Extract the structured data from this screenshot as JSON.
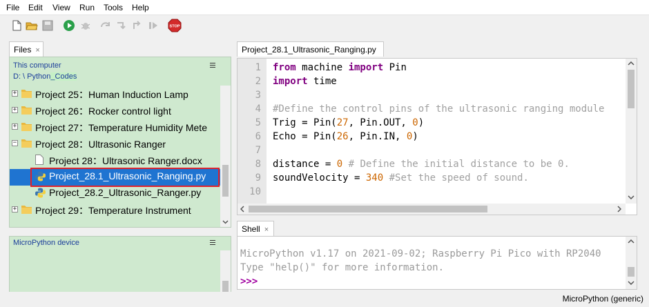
{
  "menu": [
    "File",
    "Edit",
    "View",
    "Run",
    "Tools",
    "Help"
  ],
  "toolbar": [
    "new-file-icon",
    "open-folder-icon",
    "save-icon",
    "run-icon",
    "debug-icon",
    "step-over-icon",
    "step-into-icon",
    "step-out-icon",
    "resume-icon",
    "stop-icon"
  ],
  "stop_label": "STOP",
  "files": {
    "tab_label": "Files",
    "tab_close": "×",
    "location": "This computer",
    "path_prefix": "D: \\ Python",
    "path_highlight": "_Codes",
    "menu_glyph": "≡",
    "tree": [
      {
        "label": "Project 25：Human  Induction Lamp",
        "expander": "+"
      },
      {
        "label": "Project 26：Rocker control light",
        "expander": "+"
      },
      {
        "label": "Project 27：Temperature Humidity Mete",
        "expander": "+"
      },
      {
        "label": "Project 28：Ultrasonic Ranger",
        "expander": "−"
      },
      {
        "label": "Project 28：Ultrasonic Ranger.docx"
      },
      {
        "label": "Project_28.1_Ultrasonic_Ranging.py"
      },
      {
        "label": "Project_28.2_Ultrasonic_Ranger.py"
      },
      {
        "label": "Project 29：Temperature Instrument",
        "expander": "+"
      }
    ]
  },
  "micropython_panel": {
    "title": "MicroPython device"
  },
  "editor": {
    "tab_label": "Project_28.1_Ultrasonic_Ranging.py",
    "line_numbers": [
      "1",
      "2",
      "3",
      "4",
      "5",
      "6",
      "7",
      "8",
      "9",
      "10"
    ],
    "code": {
      "l1_kw1": "from",
      "l1_mid": " machine ",
      "l1_kw2": "import",
      "l1_end": " Pin",
      "l2_kw": "import",
      "l2_end": " time",
      "l4_comment": "#Define the control pins of the ultrasonic ranging module",
      "l5_a": "Trig = Pin(",
      "l5_n1": "27",
      "l5_b": ", Pin.OUT, ",
      "l5_n2": "0",
      "l5_c": ")",
      "l6_a": "Echo = Pin(",
      "l6_n1": "26",
      "l6_b": ", Pin.IN, ",
      "l6_n2": "0",
      "l6_c": ")",
      "l8_a": "distance = ",
      "l8_n": "0",
      "l8_comment": " # Define the initial distance to be 0.",
      "l9_a": "soundVelocity = ",
      "l9_n": "340",
      "l9_comment": " #Set the speed of sound."
    }
  },
  "shell": {
    "tab_label": "Shell",
    "tab_close": "×",
    "line1": "MicroPython v1.17 on 2021-09-02; Raspberry Pi Pico with RP2040",
    "line2": "Type \"help()\" for more information.",
    "prompt": ">>>"
  },
  "status": {
    "interpreter": "MicroPython (generic)"
  },
  "colors": {
    "selection": "#1f74d1",
    "highlight_border": "#e0212b",
    "panel_green": "#cfe9cf",
    "keyword": "#800080",
    "number": "#cc6600",
    "comment": "#a0a0a0"
  }
}
